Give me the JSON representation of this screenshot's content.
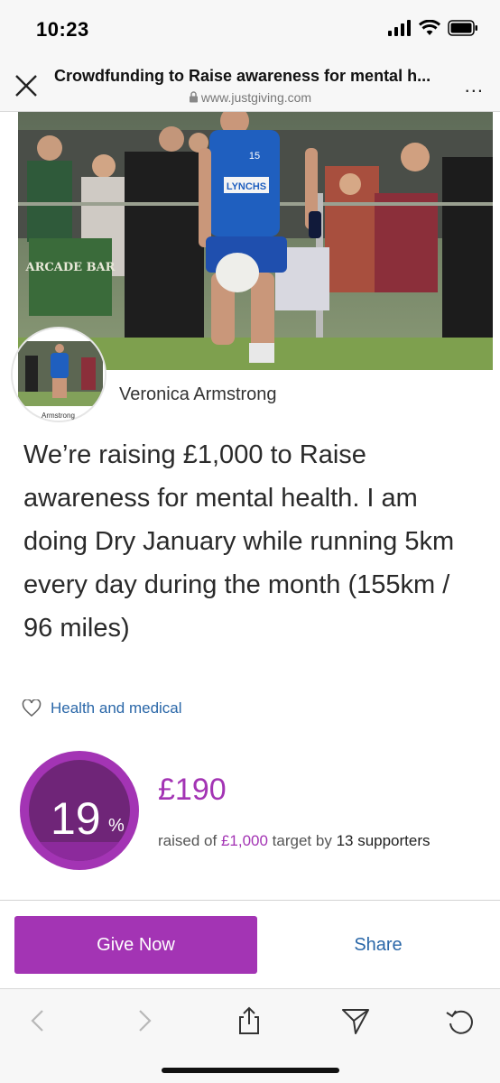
{
  "status_bar": {
    "time": "10:23"
  },
  "browser": {
    "title": "Crowdfunding to Raise awareness for mental h...",
    "url": "www.justgiving.com",
    "more_label": "..."
  },
  "fundraiser": {
    "owner_name": "Veronica Armstrong",
    "avatar_caption": "Armstrong",
    "headline": "We’re raising £1,000 to Raise awareness for mental health. I am doing Dry January while running 5km every day during the month (155km / 96 miles)",
    "category": "Health and medical",
    "hero_texts": {
      "jersey_number": "15",
      "sponsor": "LYNCHS",
      "sign": "ARCADE BAR"
    }
  },
  "progress": {
    "percent_value": "19",
    "percent_symbol": "%",
    "percent_fraction": 0.19,
    "amount_raised": "£190",
    "raised_prefix": "raised of",
    "target": "£1,000",
    "target_suffix": "target by",
    "supporters": "13 supporters"
  },
  "actions": {
    "give_label": "Give Now",
    "share_label": "Share"
  },
  "toolbar": {
    "items": [
      "back-icon",
      "forward-icon",
      "share-icon",
      "send-icon",
      "reload-icon"
    ]
  },
  "colors": {
    "brand_purple": "#a334b4",
    "link_blue": "#2a67a8"
  }
}
